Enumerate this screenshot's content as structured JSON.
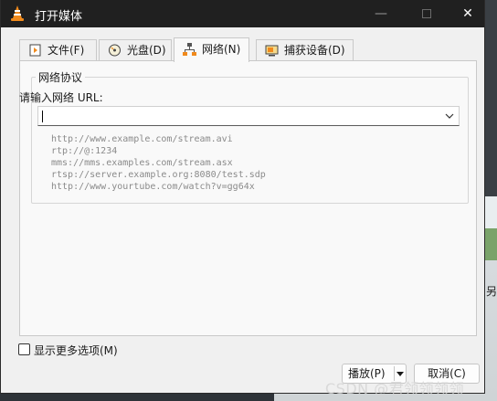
{
  "window": {
    "title": "打开媒体",
    "controls": {
      "minimize": "—",
      "maximize": "□",
      "close": "✕"
    }
  },
  "tabs": [
    {
      "label": "文件(F)",
      "icon": "file-icon"
    },
    {
      "label": "光盘(D)",
      "icon": "disc-icon"
    },
    {
      "label": "网络(N)",
      "icon": "network-icon",
      "active": true
    },
    {
      "label": "捕获设备(D)",
      "icon": "capture-device-icon"
    }
  ],
  "network": {
    "group_title": "网络协议",
    "url_label": "请输入网络 URL:",
    "url_value": "",
    "examples": [
      "http://www.example.com/stream.avi",
      "rtp://@:1234",
      "mms://mms.examples.com/stream.asx",
      "rtsp://server.example.org:8080/test.sdp",
      "http://www.yourtube.com/watch?v=gg64x"
    ]
  },
  "options": {
    "show_more_label": "显示更多选项(M)",
    "show_more_checked": false
  },
  "buttons": {
    "play": "播放(P)",
    "cancel": "取消(C)"
  },
  "watermark": "CSDN @君领领领领",
  "desktop": {
    "edge_glyph": "另"
  },
  "colors": {
    "titlebar": "#202020",
    "dialog_bg": "#f0f0f0",
    "panel_bg": "#f9f9f9",
    "vlc_orange": "#f08a1c"
  }
}
